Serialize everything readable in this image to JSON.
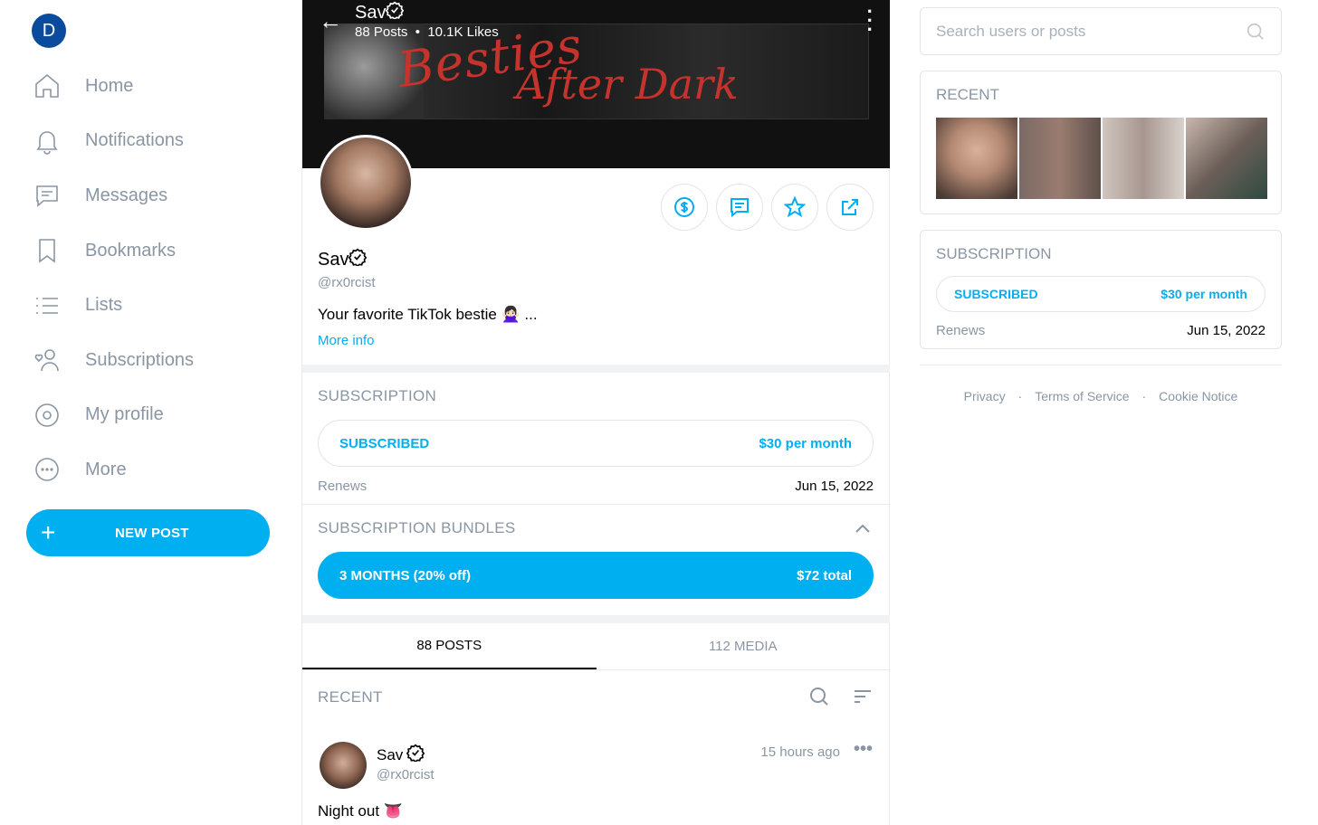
{
  "user_avatar_letter": "D",
  "nav": [
    {
      "label": "Home",
      "icon": "home-icon"
    },
    {
      "label": "Notifications",
      "icon": "bell-icon"
    },
    {
      "label": "Messages",
      "icon": "message-icon"
    },
    {
      "label": "Bookmarks",
      "icon": "bookmark-icon"
    },
    {
      "label": "Lists",
      "icon": "list-icon"
    },
    {
      "label": "Subscriptions",
      "icon": "subscriptions-icon"
    },
    {
      "label": "My profile",
      "icon": "profile-icon"
    },
    {
      "label": "More",
      "icon": "more-icon"
    }
  ],
  "new_post_label": "NEW POST",
  "header": {
    "name": "Sav",
    "posts": "88 Posts",
    "likes": "10.1K Likes",
    "cover_title_1": "Besties",
    "cover_title_2": "After Dark"
  },
  "profile": {
    "name": "Sav",
    "handle": "@rx0rcist",
    "bio": "Your favorite TikTok bestie 🙅🏻‍♀️ ...",
    "more_info": "More info"
  },
  "subscription": {
    "title": "SUBSCRIPTION",
    "status": "SUBSCRIBED",
    "price": "$30 per month",
    "renews_label": "Renews",
    "renews_date": "Jun 15, 2022"
  },
  "bundles": {
    "title": "SUBSCRIPTION BUNDLES",
    "item_label": "3 MONTHS (20% off)",
    "item_price": "$72 total"
  },
  "tabs": [
    {
      "label": "88 POSTS",
      "active": true
    },
    {
      "label": "112 MEDIA",
      "active": false
    }
  ],
  "recent_label": "RECENT",
  "post": {
    "name": "Sav",
    "handle": "@rx0rcist",
    "time": "15 hours ago",
    "text": "Night out 👅"
  },
  "right": {
    "search_placeholder": "Search users or posts",
    "recent_title": "RECENT",
    "thumb_colors": [
      "#b58a74",
      "#8e7266",
      "#a89690",
      "#6b5f58"
    ],
    "subscription_title": "SUBSCRIPTION",
    "status": "SUBSCRIBED",
    "price": "$30 per month",
    "renews_label": "Renews",
    "renews_date": "Jun 15, 2022"
  },
  "footer": [
    "Privacy",
    "Terms of Service",
    "Cookie Notice"
  ],
  "colors": {
    "accent": "#00aff0",
    "muted": "#8a96a3",
    "avatar_bg": "#0a4b9e"
  }
}
